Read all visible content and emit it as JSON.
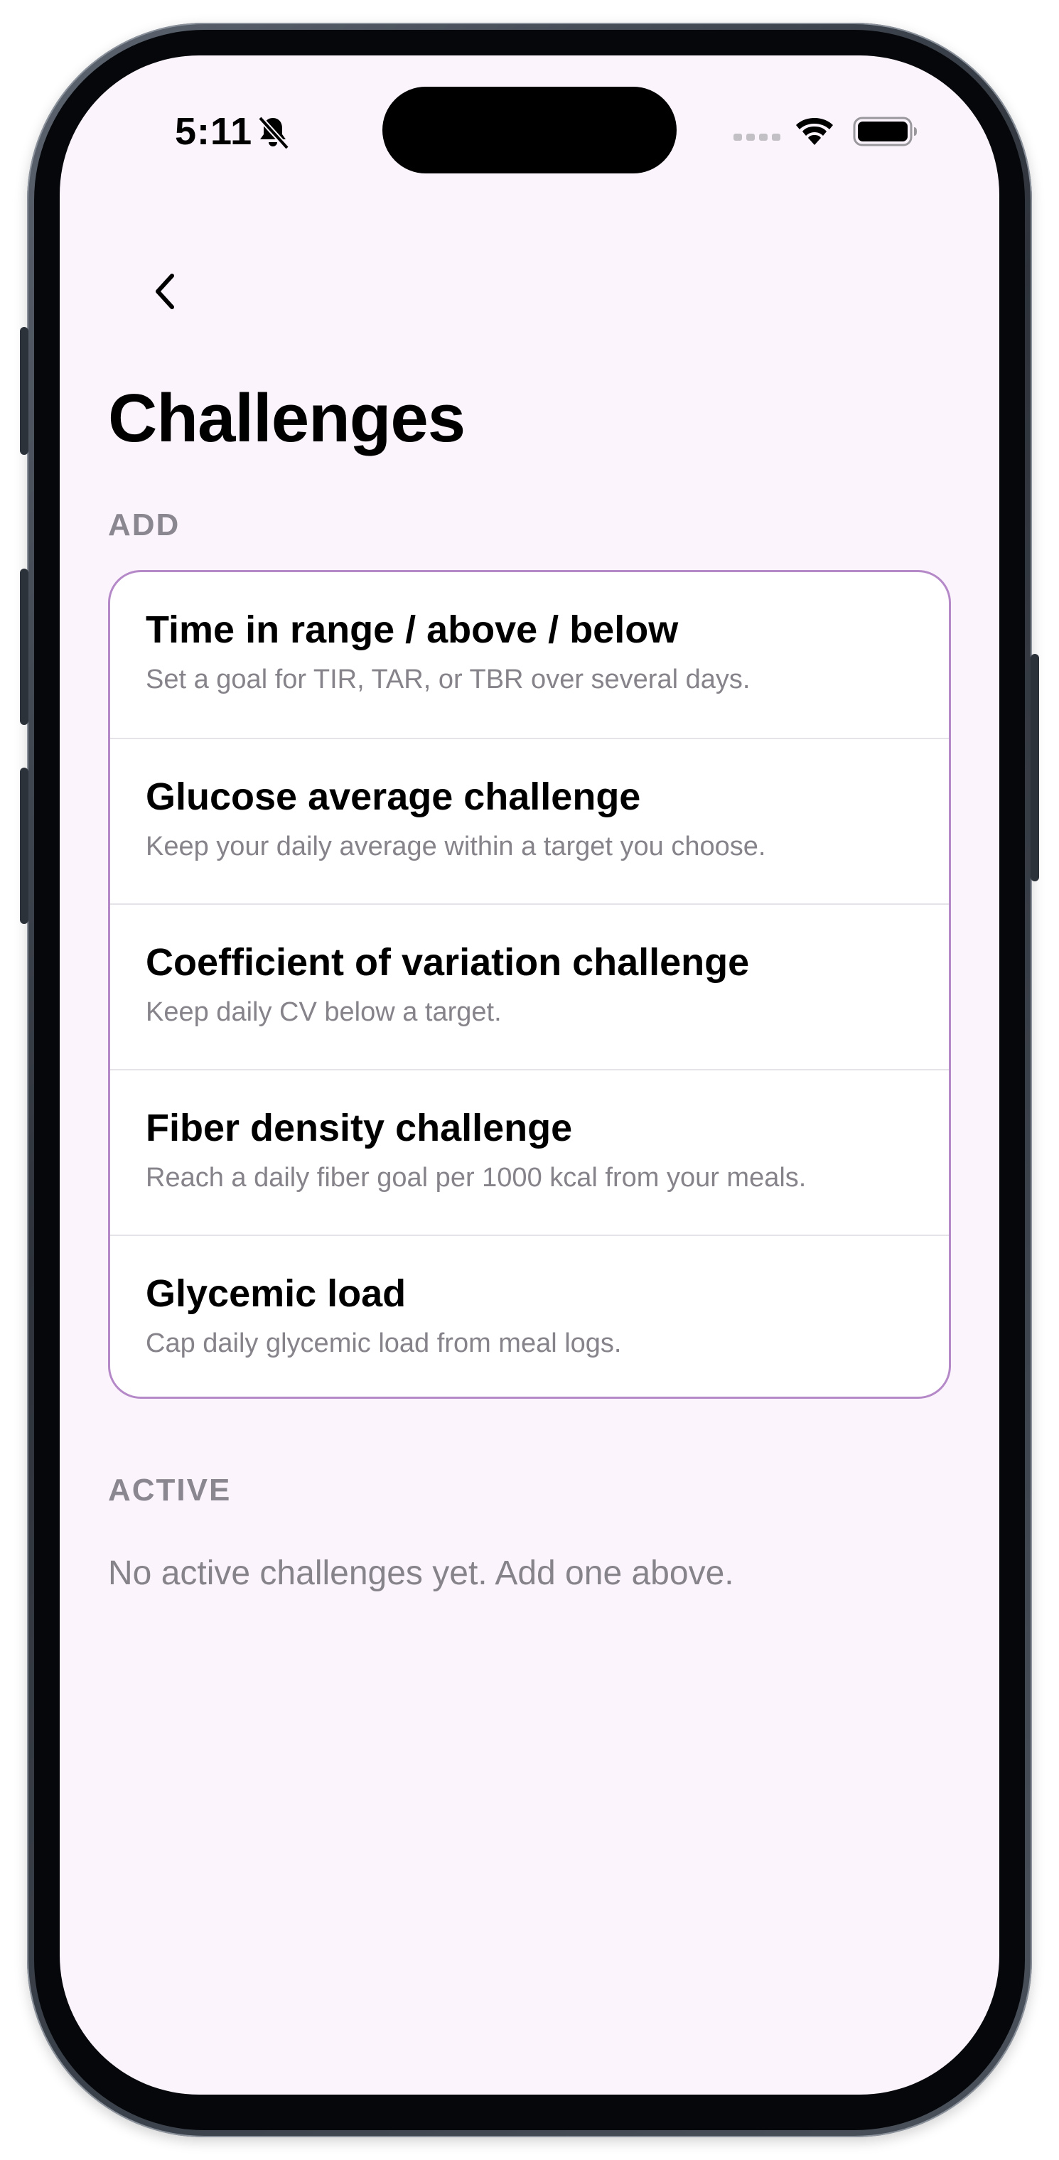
{
  "status_bar": {
    "time": "5:11",
    "icons": [
      "bell-slash-icon",
      "cellular-signal-icon",
      "wifi-icon",
      "battery-icon"
    ]
  },
  "nav": {
    "back_icon": "chevron-left-icon"
  },
  "page": {
    "title": "Challenges"
  },
  "add_section": {
    "label": "ADD",
    "items": [
      {
        "title": "Time in range / above / below",
        "description": "Set a goal for TIR, TAR, or TBR over several days."
      },
      {
        "title": "Glucose average challenge",
        "description": "Keep your daily average within a target you choose."
      },
      {
        "title": "Coefficient of variation challenge",
        "description": "Keep daily CV below a target."
      },
      {
        "title": "Fiber density challenge",
        "description": "Reach a daily fiber goal per 1000 kcal from your meals."
      },
      {
        "title": "Glycemic load",
        "description": "Cap daily glycemic load from meal logs."
      }
    ]
  },
  "active_section": {
    "label": "ACTIVE",
    "empty_message": "No active challenges yet. Add one above."
  },
  "colors": {
    "background": "#fbf4fd",
    "card_border": "#b589c8",
    "secondary_text": "#86838a",
    "section_label": "#8b8790"
  }
}
